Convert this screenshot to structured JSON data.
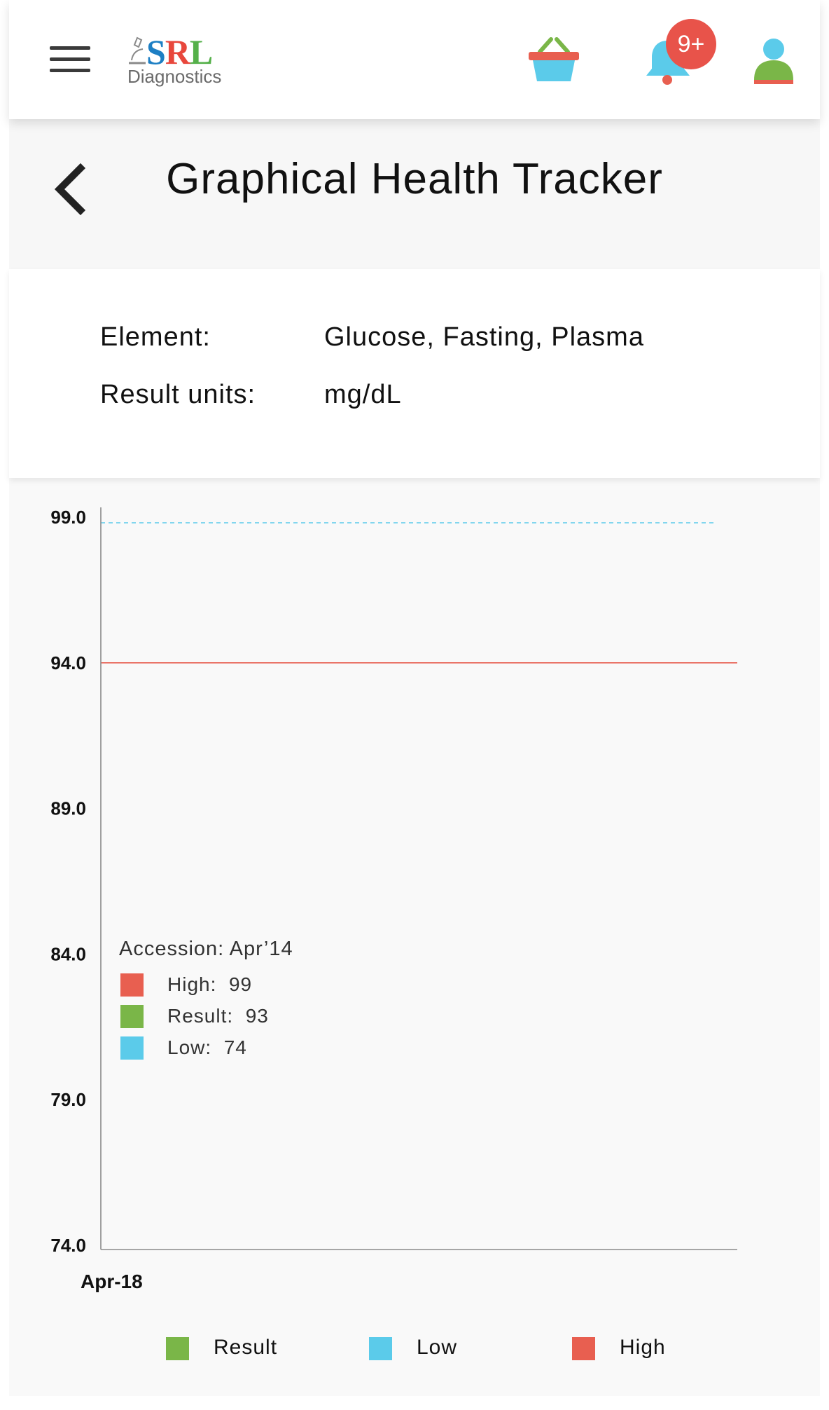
{
  "header": {
    "logo_brand": "SRL",
    "logo_sub": "Diagnostics",
    "notification_badge": "9+",
    "icons": [
      "menu-icon",
      "cart-icon",
      "bell-icon",
      "user-icon"
    ]
  },
  "page": {
    "title": "Graphical Health Tracker"
  },
  "details": {
    "element_label": "Element:",
    "element_value": "Glucose, Fasting, Plasma",
    "units_label": "Result units:",
    "units_value": "mg/dL"
  },
  "colors": {
    "result": "#7ab648",
    "low": "#5bcbea",
    "high": "#e85f50"
  },
  "chart_data": {
    "type": "line",
    "x": [
      "Apr-18"
    ],
    "xlabel": "",
    "ylabel": "",
    "ylim": [
      74.0,
      99.0
    ],
    "yticks": [
      "99.0",
      "94.0",
      "89.0",
      "84.0",
      "79.0",
      "74.0"
    ],
    "reference_lines": [
      {
        "name": "Low",
        "style": "dashed",
        "value": 99.0
      },
      {
        "name": "High",
        "style": "solid",
        "value": 94.0
      }
    ],
    "tooltip": {
      "header": "Accession: Apr’14",
      "rows": [
        {
          "label": "High:",
          "value": "99"
        },
        {
          "label": "Result:",
          "value": "93"
        },
        {
          "label": "Low:",
          "value": "74"
        }
      ]
    },
    "legend": [
      "Result",
      "Low",
      "High"
    ],
    "legend_position": "bottom",
    "grid": false
  }
}
